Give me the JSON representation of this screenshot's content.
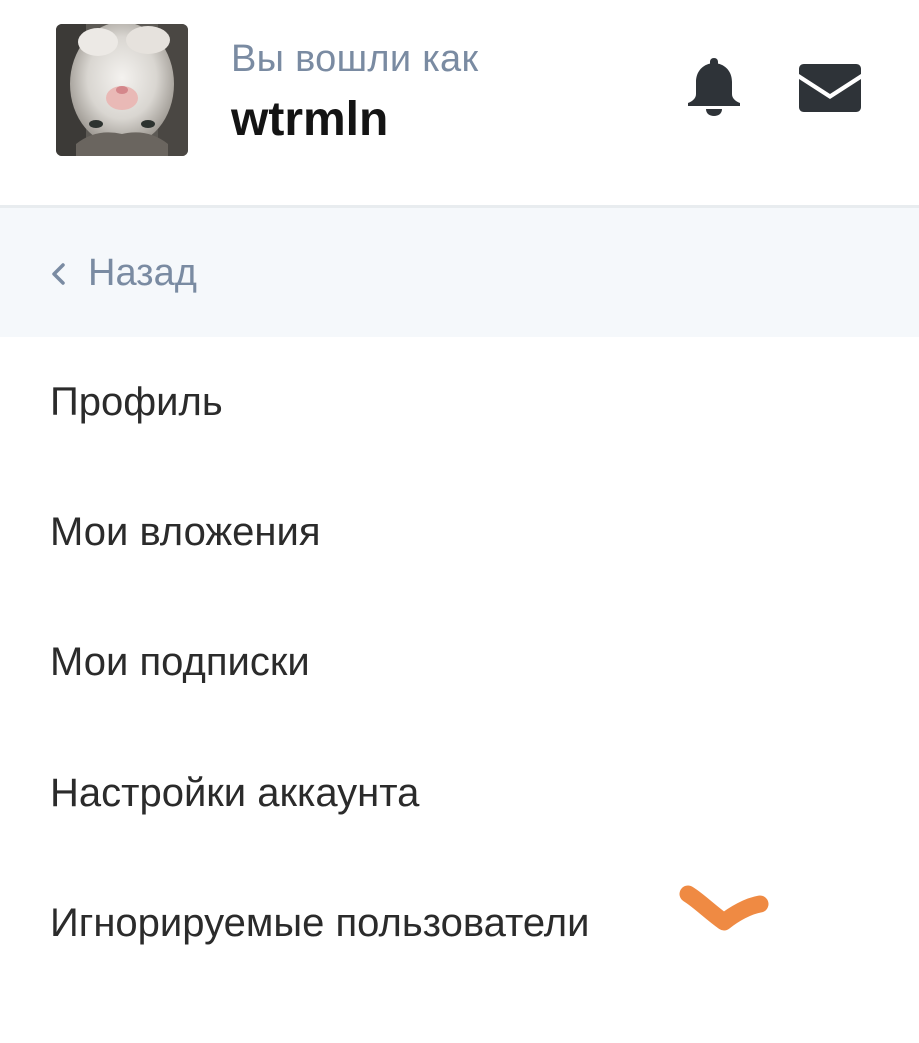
{
  "header": {
    "logged_in_label": "Вы вошли как",
    "username": "wtrmln",
    "avatar_icon": "cat-avatar-photo",
    "notifications_icon": "bell-icon",
    "messages_icon": "envelope-icon"
  },
  "nav": {
    "back_label": "Назад",
    "back_icon": "chevron-left-icon"
  },
  "menu": {
    "items": [
      {
        "label": "Профиль"
      },
      {
        "label": "Мои вложения"
      },
      {
        "label": "Мои подписки"
      },
      {
        "label": "Настройки аккаунта"
      },
      {
        "label": "Игнорируемые пользователи"
      }
    ]
  },
  "colors": {
    "muted_text": "#7a8ba2",
    "body_text": "#2b2b2b",
    "icon": "#2e3338",
    "back_bar_bg": "#f5f8fb",
    "annotation": "#ef8a43"
  }
}
